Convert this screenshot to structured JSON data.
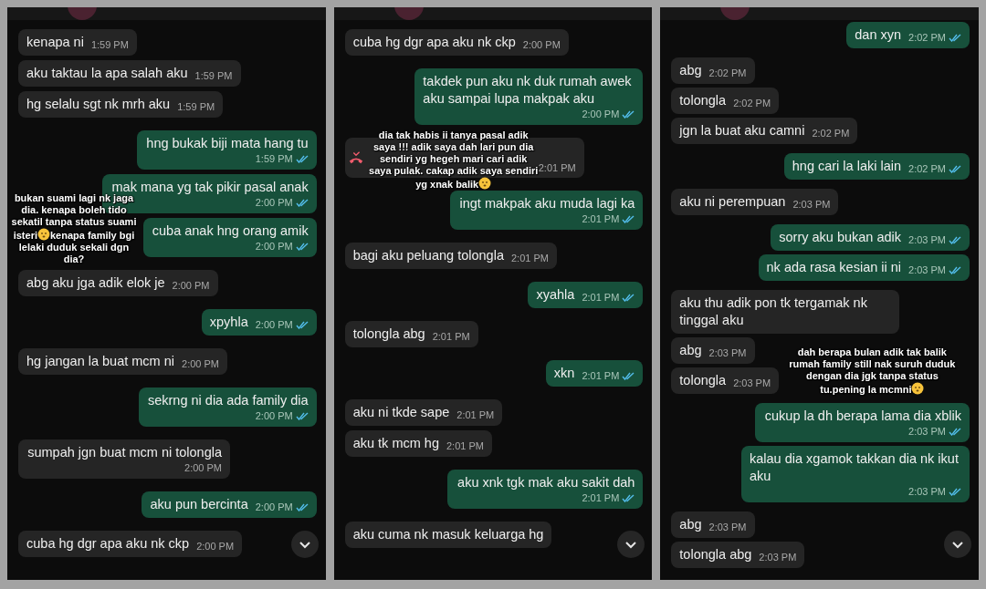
{
  "panels": [
    {
      "messages": [
        {
          "kind": "message",
          "outgoing": false,
          "text": "kenapa ni",
          "time": "1:59 PM"
        },
        {
          "kind": "message",
          "outgoing": false,
          "text": "aku taktau la apa salah aku",
          "time": "1:59 PM"
        },
        {
          "kind": "message",
          "outgoing": false,
          "text": "hg selalu sgt nk mrh aku",
          "time": "1:59 PM"
        },
        {
          "kind": "message",
          "outgoing": true,
          "text": "hng bukak biji mata hang tu",
          "time": "1:59 PM",
          "read": true
        },
        {
          "kind": "message",
          "outgoing": true,
          "text": "mak mana yg tak pikir pasal anak",
          "time": "2:00 PM",
          "read": true
        },
        {
          "kind": "message",
          "outgoing": true,
          "text": "cuba anak hng orang amik",
          "time": "2:00 PM",
          "read": true
        },
        {
          "kind": "message",
          "outgoing": false,
          "text": "abg aku jga adik elok je",
          "time": "2:00 PM"
        },
        {
          "kind": "message",
          "outgoing": true,
          "text": "xpyhla",
          "time": "2:00 PM",
          "read": true
        },
        {
          "kind": "message",
          "outgoing": false,
          "text": "hg jangan la buat mcm ni",
          "time": "2:00 PM"
        },
        {
          "kind": "message",
          "outgoing": true,
          "text": "sekrng ni dia ada family dia",
          "time": "2:00 PM",
          "read": true
        },
        {
          "kind": "message",
          "outgoing": false,
          "text": "sumpah jgn buat mcm ni tolongla",
          "time": "2:00 PM"
        },
        {
          "kind": "message",
          "outgoing": true,
          "text": "aku pun bercinta",
          "time": "2:00 PM",
          "read": true
        },
        {
          "kind": "message",
          "outgoing": false,
          "text": "cuba hg dgr apa aku nk ckp",
          "time": "2:00 PM"
        }
      ],
      "caption": [
        {
          "kind": "text",
          "text": "bukan suami lagi nk jaga dia. kenapa boleh tido sekatil tanpa status suami isteri"
        },
        {
          "kind": "emoji"
        },
        {
          "kind": "text",
          "text": "kenapa family bgi lelaki duduk sekali dgn dia?"
        }
      ]
    },
    {
      "messages": [
        {
          "kind": "message",
          "outgoing": false,
          "text": "cuba hg dgr apa aku nk ckp",
          "time": "2:00 PM"
        },
        {
          "kind": "message",
          "outgoing": true,
          "text": "takdek pun aku nk duk rumah awek aku sampai lupa makpak aku",
          "time": "2:00 PM",
          "read": true
        },
        {
          "kind": "missed_call",
          "outgoing": false,
          "time": "2:01 PM"
        },
        {
          "kind": "message",
          "outgoing": true,
          "text": "ingt makpak aku muda lagi ka",
          "time": "2:01 PM",
          "read": true
        },
        {
          "kind": "message",
          "outgoing": false,
          "text": "bagi aku peluang tolongla",
          "time": "2:01 PM"
        },
        {
          "kind": "message",
          "outgoing": true,
          "text": "xyahla",
          "time": "2:01 PM",
          "read": true
        },
        {
          "kind": "message",
          "outgoing": false,
          "text": "tolongla abg",
          "time": "2:01 PM"
        },
        {
          "kind": "message",
          "outgoing": true,
          "text": "xkn",
          "time": "2:01 PM",
          "read": true
        },
        {
          "kind": "message",
          "outgoing": false,
          "text": "aku ni tkde sape",
          "time": "2:01 PM"
        },
        {
          "kind": "message",
          "outgoing": false,
          "text": "aku tk mcm hg",
          "time": "2:01 PM"
        },
        {
          "kind": "message",
          "outgoing": true,
          "text": "aku xnk tgk mak aku sakit dah",
          "time": "2:01 PM",
          "read": true
        },
        {
          "kind": "message",
          "outgoing": false,
          "text": "aku cuma nk masuk keluarga hg"
        }
      ],
      "caption": [
        {
          "kind": "text",
          "text": "dia tak habis ii tanya pasal adik saya !!! adik saya dah lari pun dia sendiri yg hegeh mari cari adik saya pulak. cakap adik saya sendiri yg xnak balik"
        },
        {
          "kind": "emoji"
        }
      ]
    },
    {
      "messages": [
        {
          "kind": "message",
          "outgoing": true,
          "text": "dan xyn",
          "time": "2:02 PM",
          "read": true
        },
        {
          "kind": "message",
          "outgoing": false,
          "text": "abg",
          "time": "2:02 PM"
        },
        {
          "kind": "message",
          "outgoing": false,
          "text": "tolongla",
          "time": "2:02 PM"
        },
        {
          "kind": "message",
          "outgoing": false,
          "text": "jgn la buat aku camni",
          "time": "2:02 PM"
        },
        {
          "kind": "message",
          "outgoing": true,
          "text": "hng cari la laki lain",
          "time": "2:02 PM",
          "read": true
        },
        {
          "kind": "message",
          "outgoing": false,
          "text": "aku ni perempuan",
          "time": "2:03 PM"
        },
        {
          "kind": "message",
          "outgoing": true,
          "text": "sorry aku bukan adik",
          "time": "2:03 PM",
          "read": true
        },
        {
          "kind": "message",
          "outgoing": true,
          "text": "nk ada rasa kesian ii ni",
          "time": "2:03 PM",
          "read": true
        },
        {
          "kind": "message",
          "outgoing": false,
          "text": "aku thu adik pon tk tergamak nk tinggal aku"
        },
        {
          "kind": "message",
          "outgoing": false,
          "text": "abg",
          "time": "2:03 PM"
        },
        {
          "kind": "message",
          "outgoing": false,
          "text": "tolongla",
          "time": "2:03 PM"
        },
        {
          "kind": "message",
          "outgoing": true,
          "text": "cukup la dh berapa lama dia xblik",
          "time": "2:03 PM",
          "read": true
        },
        {
          "kind": "message",
          "outgoing": true,
          "text": "kalau dia xgamok takkan dia nk ikut aku",
          "time": "2:03 PM",
          "read": true
        },
        {
          "kind": "message",
          "outgoing": false,
          "text": "abg",
          "time": "2:03 PM"
        },
        {
          "kind": "message",
          "outgoing": false,
          "text": "tolongla abg",
          "time": "2:03 PM"
        }
      ],
      "caption": [
        {
          "kind": "text",
          "text": "dah berapa bulan adik tak balik rumah family still nak suruh duduk dengan dia jgk tanpa status tu.pening la mcmni"
        },
        {
          "kind": "emoji"
        }
      ]
    }
  ]
}
